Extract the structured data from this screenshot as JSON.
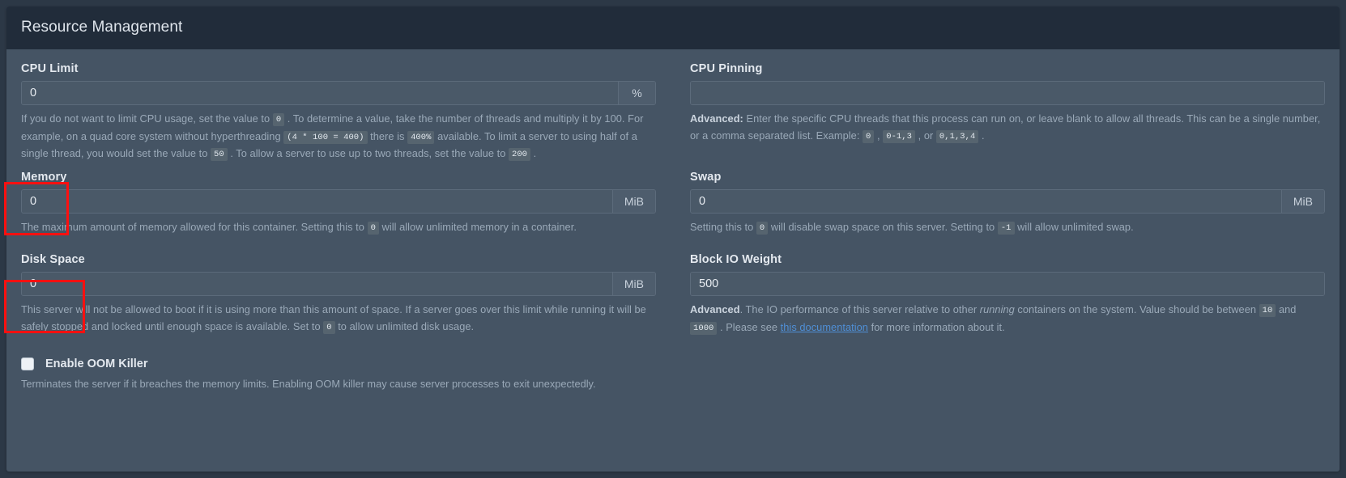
{
  "card": {
    "title": "Resource Management"
  },
  "fields": {
    "cpu_limit": {
      "label": "CPU Limit",
      "value": "0",
      "placeholder": "",
      "addon": "%",
      "help_parts": [
        {
          "t": "text",
          "v": "If you do not want to limit CPU usage, set the value to "
        },
        {
          "t": "code",
          "v": "0"
        },
        {
          "t": "text",
          "v": " . To determine a value, take the number of threads and multiply it by 100. For example, on a quad core system without hyperthreading "
        },
        {
          "t": "code",
          "v": "(4 * 100 = 400)"
        },
        {
          "t": "text",
          "v": " there is "
        },
        {
          "t": "code",
          "v": "400%"
        },
        {
          "t": "text",
          "v": " available. To limit a server to using half of a single thread, you would set the value to "
        },
        {
          "t": "code",
          "v": "50"
        },
        {
          "t": "text",
          "v": " . To allow a server to use up to two threads, set the value to "
        },
        {
          "t": "code",
          "v": "200"
        },
        {
          "t": "text",
          "v": " ."
        }
      ]
    },
    "cpu_pinning": {
      "label": "CPU Pinning",
      "value": "",
      "placeholder": "",
      "help_parts": [
        {
          "t": "bold",
          "v": "Advanced:"
        },
        {
          "t": "text",
          "v": " Enter the specific CPU threads that this process can run on, or leave blank to allow all threads. This can be a single number, or a comma separated list. Example: "
        },
        {
          "t": "code",
          "v": "0"
        },
        {
          "t": "text",
          "v": " , "
        },
        {
          "t": "code",
          "v": "0-1,3"
        },
        {
          "t": "text",
          "v": " , or "
        },
        {
          "t": "code",
          "v": "0,1,3,4"
        },
        {
          "t": "text",
          "v": " ."
        }
      ]
    },
    "memory": {
      "label": "Memory",
      "value": "0",
      "placeholder": "",
      "addon": "MiB",
      "help_parts": [
        {
          "t": "text",
          "v": "The maximum amount of memory allowed for this container. Setting this to "
        },
        {
          "t": "code",
          "v": "0"
        },
        {
          "t": "text",
          "v": " will allow unlimited memory in a container."
        }
      ]
    },
    "swap": {
      "label": "Swap",
      "value": "0",
      "placeholder": "",
      "addon": "MiB",
      "help_parts": [
        {
          "t": "text",
          "v": "Setting this to "
        },
        {
          "t": "code",
          "v": "0"
        },
        {
          "t": "text",
          "v": " will disable swap space on this server. Setting to "
        },
        {
          "t": "code",
          "v": "-1"
        },
        {
          "t": "text",
          "v": " will allow unlimited swap."
        }
      ]
    },
    "disk_space": {
      "label": "Disk Space",
      "value": "0",
      "placeholder": "",
      "addon": "MiB",
      "help_parts": [
        {
          "t": "text",
          "v": "This server will not be allowed to boot if it is using more than this amount of space. If a server goes over this limit while running it will be safely stopped and locked until enough space is available. Set to "
        },
        {
          "t": "code",
          "v": "0"
        },
        {
          "t": "text",
          "v": " to allow unlimited disk usage."
        }
      ]
    },
    "block_io_weight": {
      "label": "Block IO Weight",
      "value": "500",
      "placeholder": "",
      "help_parts": [
        {
          "t": "bold",
          "v": "Advanced"
        },
        {
          "t": "text",
          "v": ". The IO performance of this server relative to other "
        },
        {
          "t": "italic",
          "v": "running"
        },
        {
          "t": "text",
          "v": " containers on the system. Value should be between "
        },
        {
          "t": "code",
          "v": "10"
        },
        {
          "t": "text",
          "v": " and "
        },
        {
          "t": "code",
          "v": "1000"
        },
        {
          "t": "text",
          "v": " . Please see "
        },
        {
          "t": "link",
          "v": "this documentation"
        },
        {
          "t": "text",
          "v": " for more information about it."
        }
      ]
    }
  },
  "oom_killer": {
    "label": "Enable OOM Killer",
    "checked": false,
    "help": "Terminates the server if it breaches the memory limits. Enabling OOM killer may cause server processes to exit unexpectedly."
  },
  "colors": {
    "page_bg": "#2c3846",
    "card_bg": "#455464",
    "header_bg": "#212c3a",
    "input_bg": "#4a5968",
    "link": "#4f8fd6",
    "highlight": "#fc1010"
  }
}
